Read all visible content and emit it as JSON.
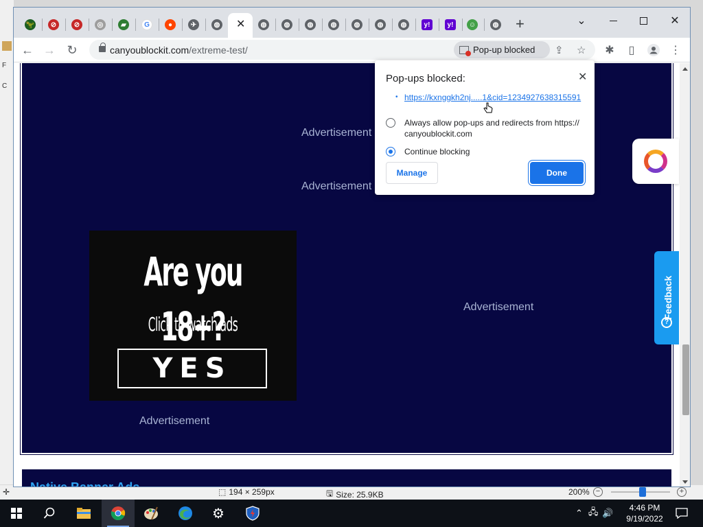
{
  "tabs": {
    "icons": [
      "green-dino-icon",
      "blocked-red-icon",
      "blocked-red-icon",
      "chrome-icon",
      "bookmark-icon",
      "google-icon",
      "reddit-icon",
      "airplane-icon",
      "globe-icon",
      "globe-icon",
      "globe-icon",
      "globe-icon",
      "globe-icon",
      "globe-icon",
      "globe-icon",
      "globe-icon",
      "yahoo-icon",
      "yahoo-icon",
      "person-icon",
      "globe-icon"
    ],
    "active_close": "✕",
    "new_tab": "+"
  },
  "window": {
    "dropdown": "⌄",
    "minimize": "",
    "maximize": "",
    "close": "✕"
  },
  "toolbar": {
    "url_host": "canyoublockit.com",
    "url_path": "/extreme-test/",
    "popup_chip": "Pop-up blocked"
  },
  "page": {
    "ad_labels": [
      "Advertisement",
      "Advertisement",
      "Advertisement",
      "Advertisement"
    ],
    "ad_headline": "Are you 18+?",
    "ad_sub": "Click to watch ads",
    "ad_button": "YES",
    "native_title": "Native Banner Ads",
    "feedback": "Feedback"
  },
  "dialog": {
    "title": "Pop-ups blocked:",
    "link": "https://kxnggkh2nj.....1&cid=1234927638315591",
    "option_allow": "Always allow pop-ups and redirects from https://canyoublockit.com",
    "option_allow_line1": "Always allow pop-ups and redirects from https://",
    "option_allow_line2": "canyoublockit.com",
    "option_block": "Continue blocking",
    "manage": "Manage",
    "done": "Done",
    "selected": "Continue blocking"
  },
  "background_app": {
    "dimensions": "194 × 259px",
    "size": "Size: 25.9KB",
    "zoom": "200%"
  },
  "taskbar": {
    "time": "4:46 PM",
    "date": "9/19/2022",
    "apps": [
      "windows-start-icon",
      "search-icon",
      "file-explorer-icon",
      "chrome-icon",
      "paint-icon",
      "edge-icon",
      "settings-icon",
      "security-shield-icon"
    ]
  }
}
